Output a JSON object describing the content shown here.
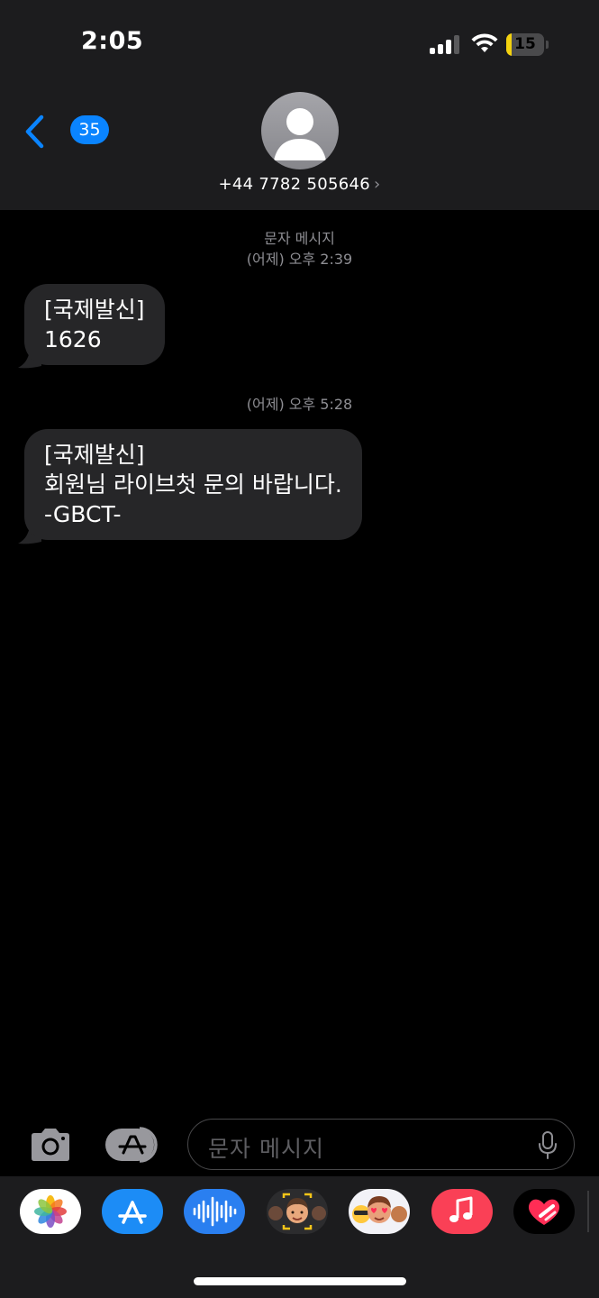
{
  "status_bar": {
    "time": "2:05",
    "battery": "15"
  },
  "header": {
    "back_count": "35",
    "contact_number": "+44 7782 505646",
    "contact_chevron": "›"
  },
  "conversation": {
    "service_label": "문자 메시지",
    "groups": [
      {
        "timestamp": "(어제) 오후 2:39",
        "message_lines": [
          "[국제발신]",
          "1626"
        ]
      },
      {
        "timestamp": "(어제) 오후 5:28",
        "message_lines": [
          "[국제발신]",
          "회원님 라이브첫 문의 바랍니다.",
          "-GBCT-"
        ]
      }
    ]
  },
  "input": {
    "placeholder": "문자 메시지"
  },
  "app_drawer": {
    "apps": [
      "photos-icon",
      "app-store-icon",
      "audio-message-icon",
      "memoji-icon",
      "memoji-stickers-icon",
      "music-icon",
      "digital-touch-icon"
    ]
  },
  "colors": {
    "accent": "#0a84ff",
    "bubble": "#262628",
    "header": "#1c1c1e",
    "battery_low": "#f4d20f",
    "music": "#fa4056"
  }
}
